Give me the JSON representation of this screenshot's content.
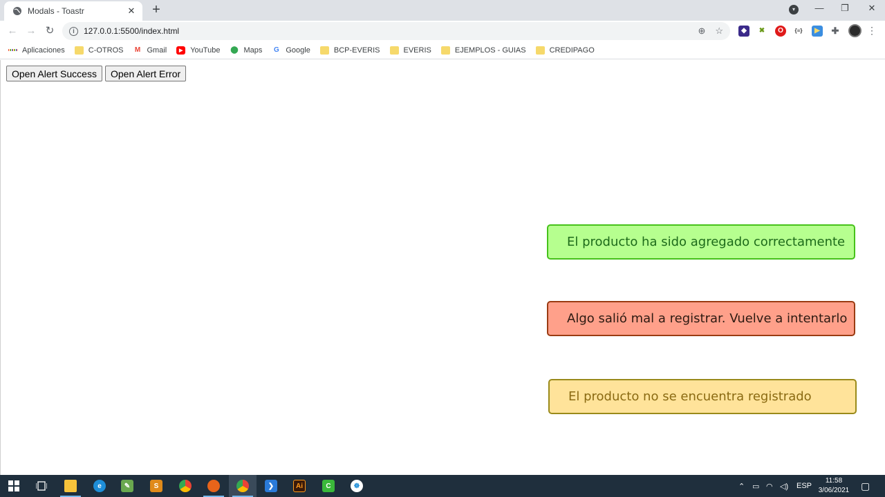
{
  "browser": {
    "tab_title": "Modals - Toastr",
    "new_tab_label": "+",
    "url": "127.0.0.1:5500/index.html",
    "bookmarks": [
      {
        "label": "Aplicaciones",
        "icon": "apps-grid-icon"
      },
      {
        "label": "C-OTROS",
        "icon": "folder-icon"
      },
      {
        "label": "Gmail",
        "icon": "gmail-icon"
      },
      {
        "label": "YouTube",
        "icon": "youtube-icon"
      },
      {
        "label": "Maps",
        "icon": "maps-icon"
      },
      {
        "label": "Google",
        "icon": "google-icon"
      },
      {
        "label": "BCP-EVERIS",
        "icon": "folder-icon"
      },
      {
        "label": "EVERIS",
        "icon": "folder-icon"
      },
      {
        "label": "EJEMPLOS - GUIAS",
        "icon": "folder-icon"
      },
      {
        "label": "CREDIPAGO",
        "icon": "folder-icon"
      }
    ]
  },
  "page": {
    "buttons": {
      "success": "Open Alert Success",
      "error": "Open Alert Error"
    },
    "toasts": {
      "success": "El producto ha sido agregado correctamente",
      "error": "Algo salió mal a registrar. Vuelve a intentarlo",
      "warning": "El producto no se encuentra registrado"
    },
    "colors": {
      "success_bg": "#b6ff8f",
      "error_bg": "#ffa08a",
      "warning_bg": "#ffe39a"
    }
  },
  "taskbar": {
    "language": "ESP",
    "time": "11:58",
    "date": "3/06/2021"
  }
}
